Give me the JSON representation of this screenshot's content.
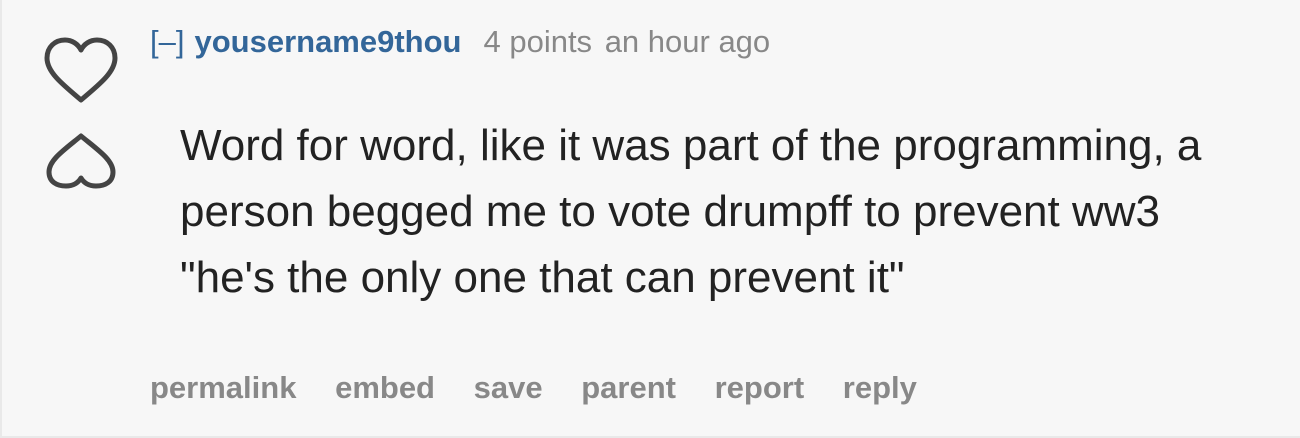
{
  "vote": {
    "up_icon": "heart-outline-icon",
    "down_icon": "broken-heart-outline-icon"
  },
  "tagline": {
    "collapse": "[–]",
    "author": "yousername9thou",
    "score": "4 points",
    "time": "an hour ago"
  },
  "comment": {
    "lines": [
      "Word for word, like it was part of the programming, a",
      "person begged me to vote drumpff to prevent ww3",
      "\"he's the only one that can prevent it\""
    ]
  },
  "actions": [
    "permalink",
    "embed",
    "save",
    "parent",
    "report",
    "reply"
  ],
  "colors": {
    "background": "#f7f7f7",
    "author": "#336699",
    "muted": "#888888",
    "text": "#222222",
    "icon": "#444444"
  }
}
